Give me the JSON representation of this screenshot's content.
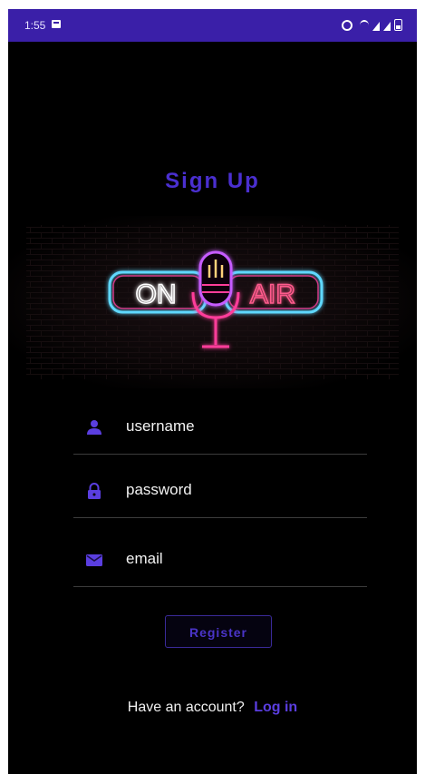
{
  "status_bar": {
    "time": "1:55",
    "icons": [
      "image-icon",
      "alarm-icon",
      "wifi-icon",
      "signal-icon",
      "signal-icon",
      "battery-icon"
    ],
    "color": "#3a1fa8"
  },
  "page": {
    "title": "Sign Up"
  },
  "logo": {
    "left_text": "ON",
    "right_text": "AIR",
    "icon": "microphone-icon"
  },
  "form": {
    "username_placeholder": "username",
    "password_placeholder": "password",
    "email_placeholder": "email",
    "register_label": "Register"
  },
  "footer": {
    "have_account_text": "Have an account?",
    "login_label": "Log in"
  },
  "colors": {
    "accent": "#4a2fd0",
    "background": "#000000",
    "neon_blue": "#5fd8ff",
    "neon_pink": "#ff3d9a"
  }
}
